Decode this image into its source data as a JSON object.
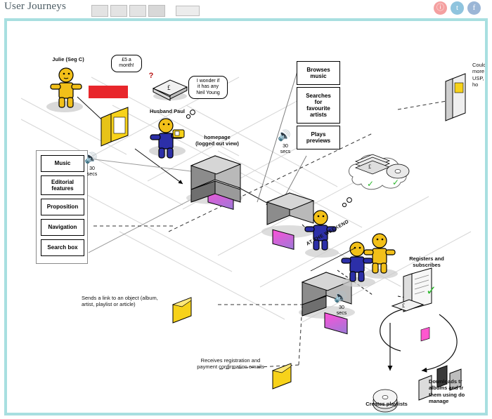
{
  "header": {
    "title": "User Journeys",
    "social_icons": [
      "rss-icon",
      "twitter-icon",
      "facebook-icon"
    ],
    "social_glyphs": [
      "ⓘ",
      "t",
      "f"
    ]
  },
  "diagram": {
    "title": "User Journeys",
    "persona_julie": "Julie (Seg C)",
    "persona_husband": "Husband Paul",
    "price_bubble": "£5 a\nmonth!",
    "thought_bubble": "I wonder if\nit has any\nNeil Young",
    "question_mark": "?",
    "homepage_label": "homepage\n(logged out view)",
    "weekend_label": "AT THE WEEKEND",
    "menu_items": [
      "Music",
      "Editorial\nfeatures",
      "Proposition",
      "Navigation",
      "Search box"
    ],
    "action_boxes": [
      "Browses\nmusic",
      "Searches\nfor\nfavourite\nartists",
      "Plays\npreviews"
    ],
    "timers": [
      {
        "name": "timer-menu",
        "value": "30\nsecs"
      },
      {
        "name": "timer-actions",
        "value": "30\nsecs"
      },
      {
        "name": "timer-weekend",
        "value": "30\nsecs"
      }
    ],
    "registers_label": "Registers and\nsubscribes",
    "sends_link_label": "Sends a link to an object (album,\nartist, playlist or article)",
    "receives_email_label": "Receives registration and\npayment confirmation emails",
    "creates_playlists_label": "Creates  playlists",
    "downloads_label": "Downloads tr\nalbums and tr\nthem using do\nmanage",
    "poster_label": "Could d\nmore a\nUSP, s\nho",
    "money_symbol": "£",
    "ticks": [
      "✓",
      "✓",
      "✓"
    ]
  }
}
